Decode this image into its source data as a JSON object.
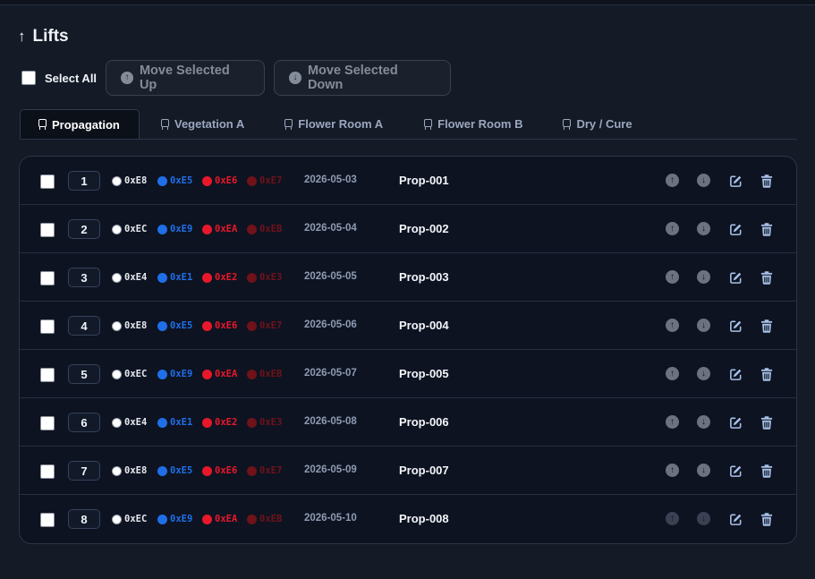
{
  "header": {
    "title": "Lifts",
    "title_icon": "arrow-up-icon"
  },
  "controls": {
    "select_all_label": "Select All",
    "move_up_label": "Move Selected Up",
    "move_down_label": "Move Selected Down"
  },
  "tabs": [
    {
      "label": "Propagation",
      "active": true
    },
    {
      "label": "Vegetation A",
      "active": false
    },
    {
      "label": "Flower Room A",
      "active": false
    },
    {
      "label": "Flower Room B",
      "active": false
    },
    {
      "label": "Dry / Cure",
      "active": false
    }
  ],
  "colors": {
    "white_code": "#ffffff",
    "blue_code": "#1f6fe8",
    "red_code": "#e8182a",
    "dark_red_code": "#701219"
  },
  "rows": [
    {
      "index": "1",
      "white": "0xE8",
      "blue": "0xE5",
      "red": "0xE6",
      "dark": "0xE7",
      "date": "2026-05-03",
      "name": "Prop-001"
    },
    {
      "index": "2",
      "white": "0xEC",
      "blue": "0xE9",
      "red": "0xEA",
      "dark": "0xEB",
      "date": "2026-05-04",
      "name": "Prop-002"
    },
    {
      "index": "3",
      "white": "0xE4",
      "blue": "0xE1",
      "red": "0xE2",
      "dark": "0xE3",
      "date": "2026-05-05",
      "name": "Prop-003"
    },
    {
      "index": "4",
      "white": "0xE8",
      "blue": "0xE5",
      "red": "0xE6",
      "dark": "0xE7",
      "date": "2026-05-06",
      "name": "Prop-004"
    },
    {
      "index": "5",
      "white": "0xEC",
      "blue": "0xE9",
      "red": "0xEA",
      "dark": "0xEB",
      "date": "2026-05-07",
      "name": "Prop-005"
    },
    {
      "index": "6",
      "white": "0xE4",
      "blue": "0xE1",
      "red": "0xE2",
      "dark": "0xE3",
      "date": "2026-05-08",
      "name": "Prop-006"
    },
    {
      "index": "7",
      "white": "0xE8",
      "blue": "0xE5",
      "red": "0xE6",
      "dark": "0xE7",
      "date": "2026-05-09",
      "name": "Prop-007"
    },
    {
      "index": "8",
      "white": "0xEC",
      "blue": "0xE9",
      "red": "0xEA",
      "dark": "0xEB",
      "date": "2026-05-10",
      "name": "Prop-008"
    }
  ]
}
